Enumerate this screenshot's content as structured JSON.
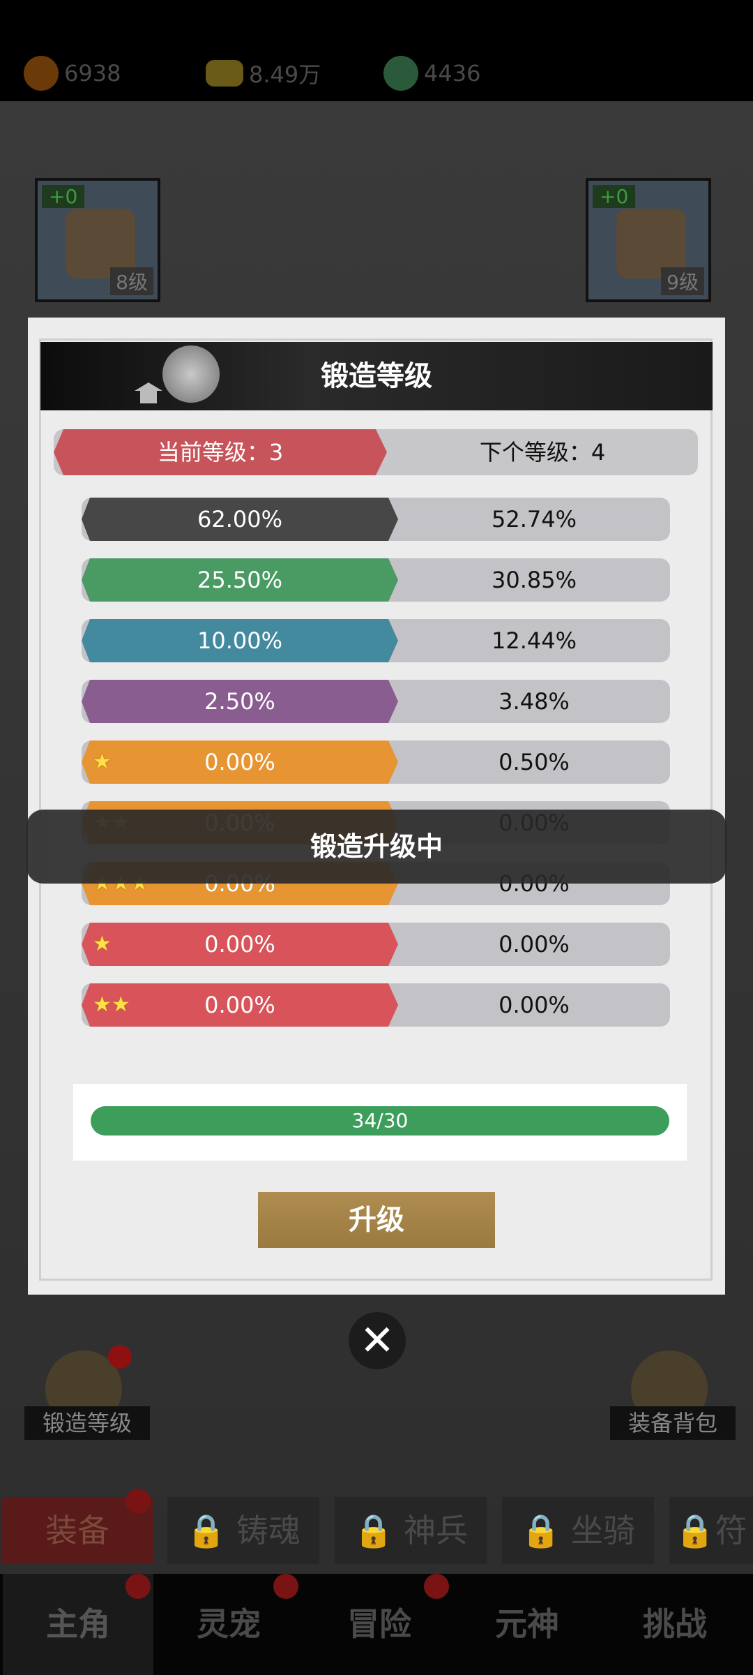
{
  "resources": [
    {
      "icon": "flame-icon",
      "value": "6938",
      "color": "#6a3a08"
    },
    {
      "icon": "gold-ingot-icon",
      "value": "8.49万",
      "color": "#6a5a18"
    },
    {
      "icon": "jade-icon",
      "value": "4436",
      "color": "#2a5a3a"
    }
  ],
  "equipment": {
    "left": {
      "plus": "+0",
      "level": "8级"
    },
    "right": {
      "plus": "+0",
      "level": "9级"
    }
  },
  "modal": {
    "title": "锻造等级",
    "current_level": "当前等级：3",
    "next_level": "下个等级：4",
    "rates": [
      {
        "stars": "",
        "current": "62.00%",
        "next": "52.74%",
        "color": "#474747"
      },
      {
        "stars": "",
        "current": "25.50%",
        "next": "30.85%",
        "color": "#4a9a64"
      },
      {
        "stars": "",
        "current": "10.00%",
        "next": "12.44%",
        "color": "#438a9f"
      },
      {
        "stars": "",
        "current": "2.50%",
        "next": "3.48%",
        "color": "#8a5d90"
      },
      {
        "stars": "★",
        "current": "0.00%",
        "next": "0.50%",
        "color": "#e79433"
      },
      {
        "stars": "★★",
        "current": "0.00%",
        "next": "0.00%",
        "color": "#e79433"
      },
      {
        "stars": "★★★",
        "current": "0.00%",
        "next": "0.00%",
        "color": "#e79433"
      },
      {
        "stars": "★",
        "current": "0.00%",
        "next": "0.00%",
        "color": "#d8545a"
      },
      {
        "stars": "★★",
        "current": "0.00%",
        "next": "0.00%",
        "color": "#d8545a"
      }
    ],
    "progress": {
      "label": "34/30",
      "value": 1.0
    },
    "upgrade_label": "升级"
  },
  "toast": "锻造升级中",
  "features": {
    "forge_level": "锻造等级",
    "equipment_bag": "装备背包"
  },
  "sub_tabs": [
    "装备",
    "铸魂",
    "神兵",
    "坐骑",
    "符"
  ],
  "bottom_nav": [
    "主角",
    "灵宠",
    "冒险",
    "元神",
    "挑战"
  ]
}
